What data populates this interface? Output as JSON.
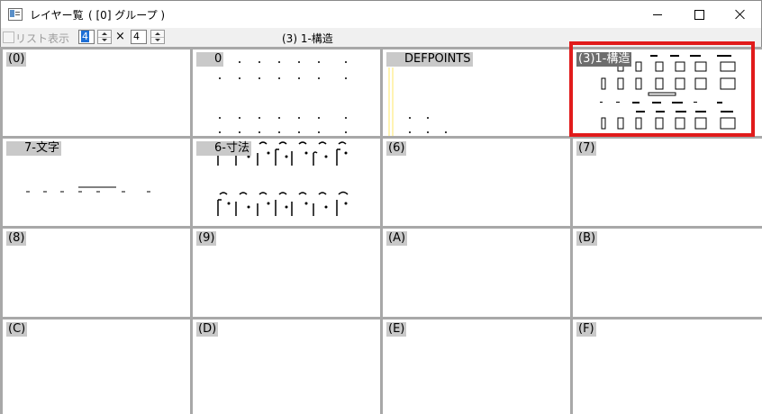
{
  "window": {
    "title": "レイヤー覧",
    "group": "( [0] グループ )"
  },
  "toolbar": {
    "list_label": "リスト表示",
    "rows": "4",
    "cols": "4",
    "times_sign": "×",
    "current_layer": "(3) 1-構造"
  },
  "layers": [
    {
      "label": "(0)"
    },
    {
      "label": "0"
    },
    {
      "label": "DEFPOINTS"
    },
    {
      "label": "(3)1-構造"
    },
    {
      "label": "7-文字"
    },
    {
      "label": "6-寸法"
    },
    {
      "label": "(6)"
    },
    {
      "label": "(7)"
    },
    {
      "label": "(8)"
    },
    {
      "label": "(9)"
    },
    {
      "label": "(A)"
    },
    {
      "label": "(B)"
    },
    {
      "label": "(C)"
    },
    {
      "label": "(D)"
    },
    {
      "label": "(E)"
    },
    {
      "label": "(F)"
    }
  ],
  "colors": {
    "highlight": "#e11b1b",
    "defpoints_line": "#ffe766",
    "selected_label_bg": "#6d6d6d"
  }
}
